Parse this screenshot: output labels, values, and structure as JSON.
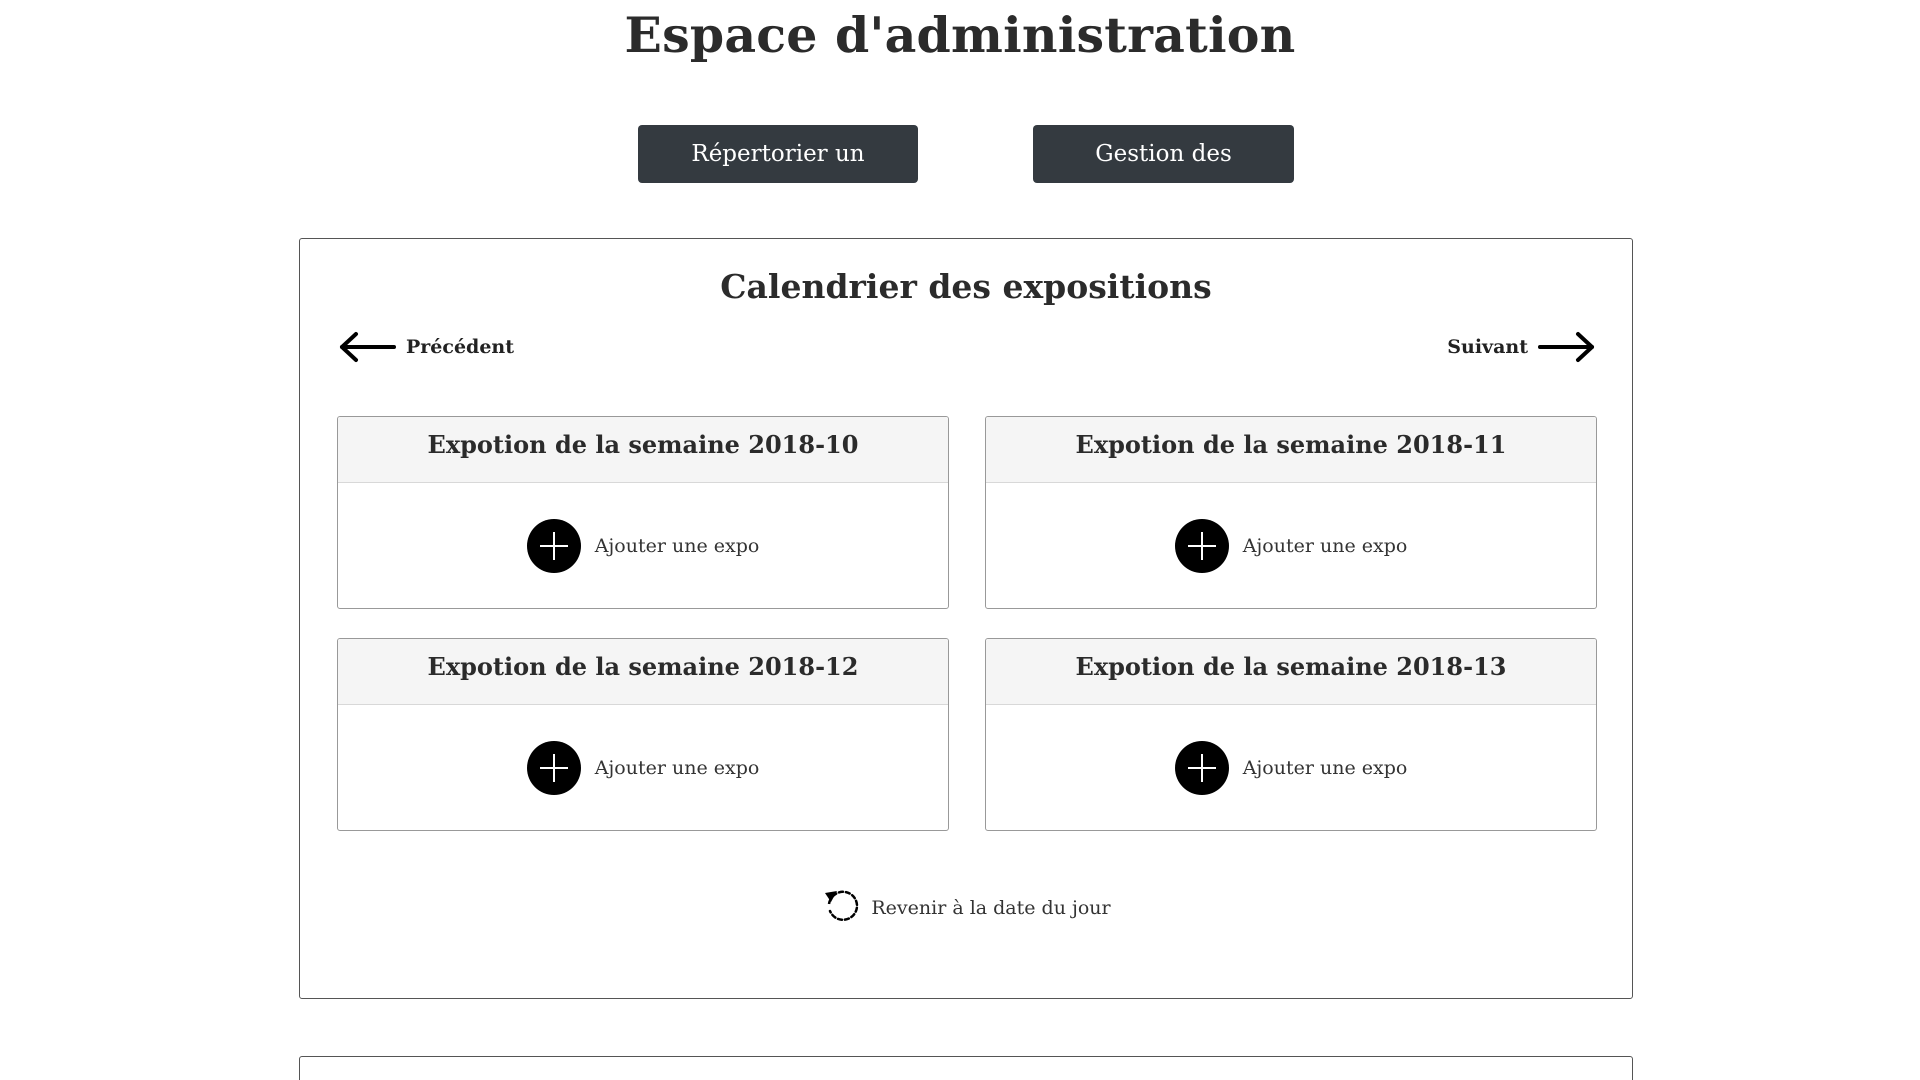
{
  "header": {
    "title": "Espace d'administration"
  },
  "actions": {
    "register_label": "Répertorier un artiste",
    "manage_label": "Gestion des artistes"
  },
  "calendar": {
    "title": "Calendrier des expositions",
    "prev_label": "Précédent",
    "next_label": "Suivant",
    "weeks": [
      {
        "title": "Expotion de la semaine 2018-10",
        "add_label": "Ajouter une expo"
      },
      {
        "title": "Expotion de la semaine 2018-11",
        "add_label": "Ajouter une expo"
      },
      {
        "title": "Expotion de la semaine 2018-12",
        "add_label": "Ajouter une expo"
      },
      {
        "title": "Expotion de la semaine 2018-13",
        "add_label": "Ajouter une expo"
      }
    ],
    "reset_label": "Revenir à la date du jour"
  },
  "icons": {
    "prev": "arrow-left-icon",
    "next": "arrow-right-icon",
    "add": "plus-circle-icon",
    "reset": "rotate-ccw-icon"
  },
  "colors": {
    "button_bg": "#343a40",
    "button_text": "#ffffff",
    "card_header_bg": "#f5f5f5"
  }
}
